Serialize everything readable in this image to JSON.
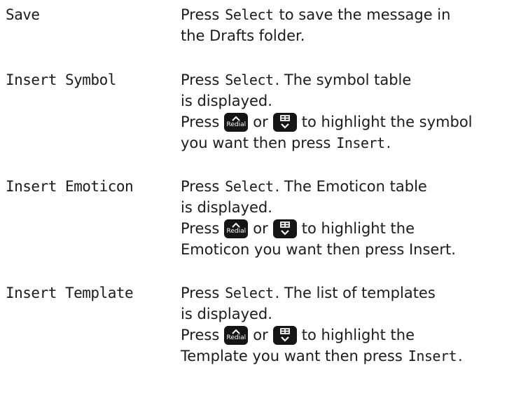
{
  "entries": [
    {
      "term": "Save",
      "lines": [
        [
          "Press",
          "Select",
          "to save the message in"
        ],
        [
          "the Drafts folder."
        ]
      ]
    },
    {
      "term": "Insert Symbol",
      "lines": [
        [
          "Press",
          "Select",
          ". The symbol table"
        ],
        [
          "is displayed."
        ],
        [
          "Press",
          "or",
          "to highlight the symbol"
        ],
        [
          "you want then press",
          "Insert",
          "."
        ]
      ]
    },
    {
      "term": "Insert Emoticon",
      "lines": [
        [
          "Press",
          "Select",
          ". The Emoticon table"
        ],
        [
          "is displayed."
        ],
        [
          "Press",
          "or",
          "to highlight the"
        ],
        [
          "Emoticon you want then press Insert."
        ]
      ]
    },
    {
      "term": "Insert Template",
      "lines": [
        [
          "Press",
          "Select",
          ". The list of templates"
        ],
        [
          "is displayed."
        ],
        [
          "Press",
          "or",
          "to highlight the"
        ],
        [
          "Template you want then press",
          "Insert",
          "."
        ]
      ]
    }
  ],
  "keys": {
    "up_key_label": "Redial",
    "up_key_icon": "chevron-up-icon",
    "down_key_icon": "phonebook-icon"
  }
}
